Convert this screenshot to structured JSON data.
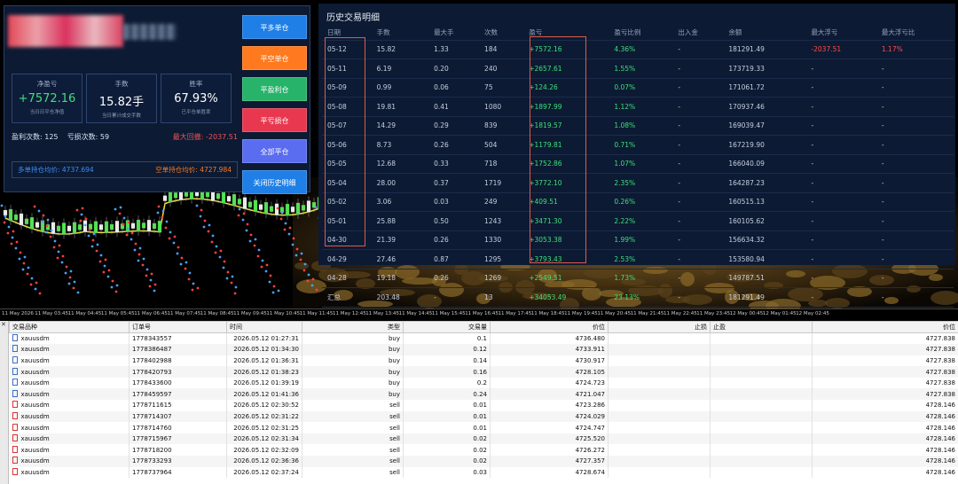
{
  "colors": {
    "green": "#3ee07a",
    "red": "#ff4d4d",
    "bg": "#0c1a33",
    "btn_blue": "#1f7fe6",
    "btn_orange": "#ff7a1f",
    "btn_green": "#27b36a",
    "btn_red": "#e8384f",
    "btn_purple": "#5a6df0"
  },
  "buttons": [
    {
      "label": "平多单仓",
      "color": "#1f7fe6"
    },
    {
      "label": "平空单仓",
      "color": "#ff7a1f"
    },
    {
      "label": "平盈利仓",
      "color": "#27b36a"
    },
    {
      "label": "平亏损仓",
      "color": "#e8384f"
    },
    {
      "label": "全部平仓",
      "color": "#5a6df0"
    },
    {
      "label": "关闭历史明细",
      "color": "#1f7fe6"
    }
  ],
  "kpis": [
    {
      "title": "净盈亏",
      "value": "+7572.16",
      "sub": "当日日平仓净值",
      "color": "#3ee07a"
    },
    {
      "title": "手数",
      "value": "15.82手",
      "sub": "当日累计成交手数",
      "color": "#ffffff"
    },
    {
      "title": "胜率",
      "value": "67.93%",
      "sub": "已平仓单胜率",
      "color": "#ffffff"
    }
  ],
  "stats": {
    "win_label": "盈利次数: 125",
    "loss_label": "亏损次数: 59",
    "drawdown_label": "最大回撤: -2037.51"
  },
  "avg": {
    "long": "多单持仓均价: 4737.694",
    "short": "空单持仓均价: 4727.984"
  },
  "history": {
    "title": "历史交易明细",
    "headers": [
      "日期",
      "手数",
      "最大手",
      "次数",
      "盈亏",
      "盈亏比例",
      "出入金",
      "余额",
      "最大浮亏",
      "最大浮亏比"
    ],
    "rows": [
      [
        "05-12",
        "15.82",
        "1.33",
        "184",
        "+7572.16",
        "4.36%",
        "-",
        "181291.49",
        "-2037.51",
        "1.17%"
      ],
      [
        "05-11",
        "6.19",
        "0.20",
        "240",
        "+2657.61",
        "1.55%",
        "-",
        "173719.33",
        "-",
        "-"
      ],
      [
        "05-09",
        "0.99",
        "0.06",
        "75",
        "+124.26",
        "0.07%",
        "-",
        "171061.72",
        "-",
        "-"
      ],
      [
        "05-08",
        "19.81",
        "0.41",
        "1080",
        "+1897.99",
        "1.12%",
        "-",
        "170937.46",
        "-",
        "-"
      ],
      [
        "05-07",
        "14.29",
        "0.29",
        "839",
        "+1819.57",
        "1.08%",
        "-",
        "169039.47",
        "-",
        "-"
      ],
      [
        "05-06",
        "8.73",
        "0.26",
        "504",
        "+1179.81",
        "0.71%",
        "-",
        "167219.90",
        "-",
        "-"
      ],
      [
        "05-05",
        "12.68",
        "0.33",
        "718",
        "+1752.86",
        "1.07%",
        "-",
        "166040.09",
        "-",
        "-"
      ],
      [
        "05-04",
        "28.00",
        "0.37",
        "1719",
        "+3772.10",
        "2.35%",
        "-",
        "164287.23",
        "-",
        "-"
      ],
      [
        "05-02",
        "3.06",
        "0.03",
        "249",
        "+409.51",
        "0.26%",
        "-",
        "160515.13",
        "-",
        "-"
      ],
      [
        "05-01",
        "25.88",
        "0.50",
        "1243",
        "+3471.30",
        "2.22%",
        "-",
        "160105.62",
        "-",
        "-"
      ],
      [
        "04-30",
        "21.39",
        "0.26",
        "1330",
        "+3053.38",
        "1.99%",
        "-",
        "156634.32",
        "-",
        "-"
      ],
      [
        "04-29",
        "27.46",
        "0.87",
        "1295",
        "+3793.43",
        "2.53%",
        "-",
        "153580.94",
        "-",
        "-"
      ],
      [
        "04-28",
        "19.18",
        "0.26",
        "1269",
        "+2549.51",
        "1.73%",
        "-",
        "149787.51",
        "-",
        "-"
      ]
    ],
    "summary": [
      "汇总",
      "203.48",
      "-",
      "13",
      "+34053.49",
      "23.13%",
      "-",
      "181291.49",
      "-",
      "-"
    ]
  },
  "axis": [
    "11 May 2026",
    "11 May 03:45",
    "11 May 04:45",
    "11 May 05:45",
    "11 May 06:45",
    "11 May 07:45",
    "11 May 08:45",
    "11 May 09:45",
    "11 May 10:45",
    "11 May 11:45",
    "11 May 12:45",
    "11 May 13:45",
    "11 May 14:45",
    "11 May 15:45",
    "11 May 16:45",
    "11 May 17:45",
    "11 May 18:45",
    "11 May 19:45",
    "11 May 20:45",
    "11 May 21:45",
    "11 May 22:45",
    "11 May 23:45",
    "12 May 00:45",
    "12 May 01:45",
    "12 May 02:45"
  ],
  "orders": {
    "headers": [
      "交易品种",
      "订单号",
      "时间",
      "类型",
      "交易量",
      "价位",
      "止损",
      "止盈",
      "价位"
    ],
    "rows": [
      [
        "xauusdm",
        "1778343557",
        "2026.05.12 01:27:31",
        "buy",
        "0.1",
        "4736.480",
        "",
        "",
        "4727.838"
      ],
      [
        "xauusdm",
        "1778386487",
        "2026.05.12 01:34:30",
        "buy",
        "0.12",
        "4733.911",
        "",
        "",
        "4727.838"
      ],
      [
        "xauusdm",
        "1778402988",
        "2026.05.12 01:36:31",
        "buy",
        "0.14",
        "4730.917",
        "",
        "",
        "4727.838"
      ],
      [
        "xauusdm",
        "1778420793",
        "2026.05.12 01:38:23",
        "buy",
        "0.16",
        "4728.105",
        "",
        "",
        "4727.838"
      ],
      [
        "xauusdm",
        "1778433600",
        "2026.05.12 01:39:19",
        "buy",
        "0.2",
        "4724.723",
        "",
        "",
        "4727.838"
      ],
      [
        "xauusdm",
        "1778459597",
        "2026.05.12 01:41:36",
        "buy",
        "0.24",
        "4721.047",
        "",
        "",
        "4727.838"
      ],
      [
        "xauusdm",
        "1778711615",
        "2026.05.12 02:30:52",
        "sell",
        "0.01",
        "4723.286",
        "",
        "",
        "4728.146"
      ],
      [
        "xauusdm",
        "1778714307",
        "2026.05.12 02:31:22",
        "sell",
        "0.01",
        "4724.029",
        "",
        "",
        "4728.146"
      ],
      [
        "xauusdm",
        "1778714760",
        "2026.05.12 02:31:25",
        "sell",
        "0.01",
        "4724.747",
        "",
        "",
        "4728.146"
      ],
      [
        "xauusdm",
        "1778715967",
        "2026.05.12 02:31:34",
        "sell",
        "0.02",
        "4725.520",
        "",
        "",
        "4728.146"
      ],
      [
        "xauusdm",
        "1778718200",
        "2026.05.12 02:32:09",
        "sell",
        "0.02",
        "4726.272",
        "",
        "",
        "4728.146"
      ],
      [
        "xauusdm",
        "1778733293",
        "2026.05.12 02:36:36",
        "sell",
        "0.02",
        "4727.357",
        "",
        "",
        "4728.146"
      ],
      [
        "xauusdm",
        "1778737964",
        "2026.05.12 02:37:24",
        "sell",
        "0.03",
        "4728.674",
        "",
        "",
        "4728.146"
      ]
    ]
  }
}
